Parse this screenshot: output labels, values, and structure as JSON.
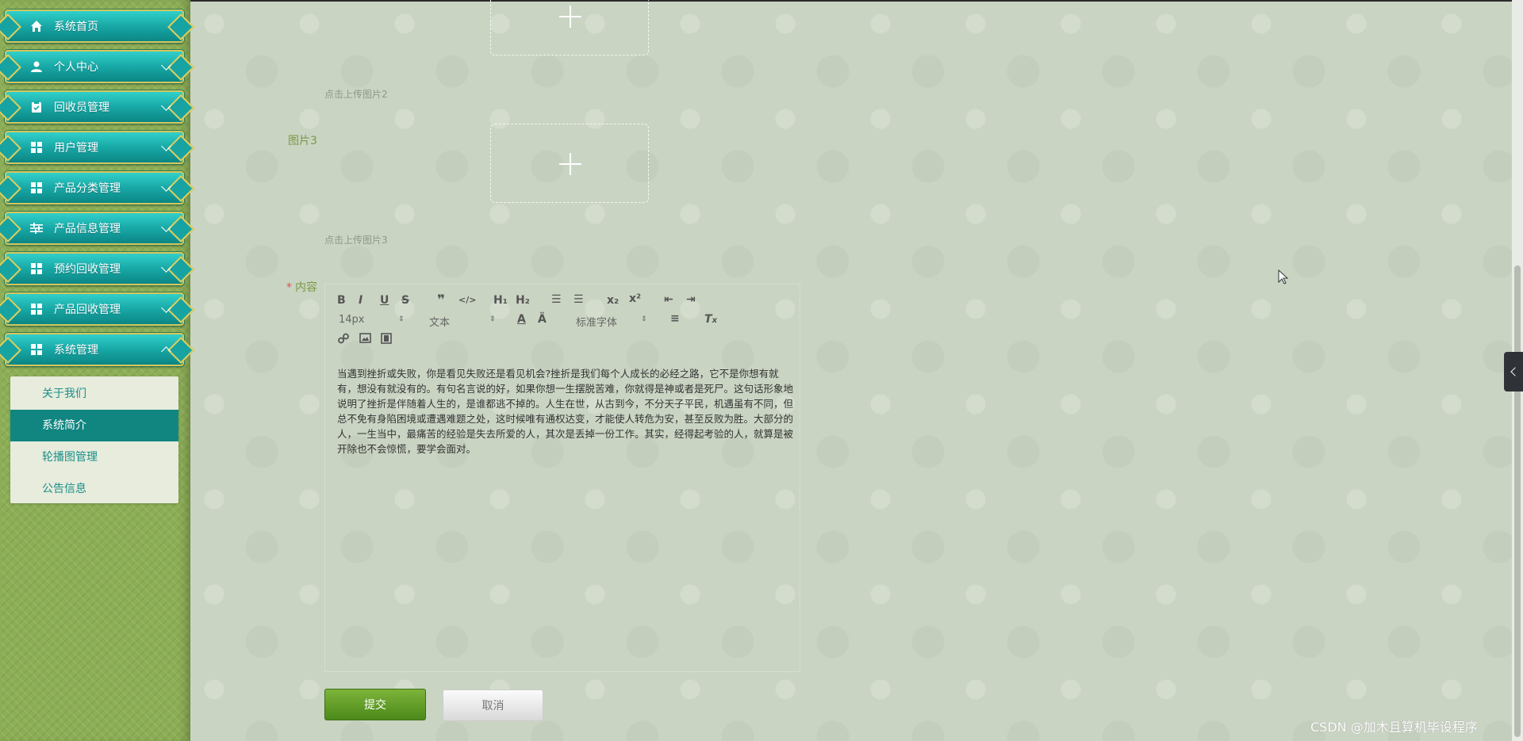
{
  "sidebar": {
    "menus": [
      {
        "label": "系统首页",
        "icon": "home-icon"
      },
      {
        "label": "个人中心",
        "icon": "user-icon"
      },
      {
        "label": "回收员管理",
        "icon": "clipboard-icon"
      },
      {
        "label": "用户管理",
        "icon": "grid-icon"
      },
      {
        "label": "产品分类管理",
        "icon": "grid-icon"
      },
      {
        "label": "产品信息管理",
        "icon": "sliders-icon"
      },
      {
        "label": "预约回收管理",
        "icon": "grid-icon"
      },
      {
        "label": "产品回收管理",
        "icon": "grid-icon"
      },
      {
        "label": "系统管理",
        "icon": "grid-icon"
      }
    ],
    "submenu": [
      {
        "label": "关于我们"
      },
      {
        "label": "系统简介",
        "active": true
      },
      {
        "label": "轮播图管理"
      },
      {
        "label": "公告信息"
      }
    ]
  },
  "form": {
    "upload2_tip": "点击上传图片2",
    "image3_label": "图片3",
    "upload3_tip": "点击上传图片3",
    "content_label": "内容",
    "required_mark": "*"
  },
  "editor": {
    "font_size": "14px",
    "paragraph": "文本",
    "font_family": "标准字体",
    "content": "当遇到挫折或失败，你是看见失败还是看见机会?挫折是我们每个人成长的必经之路，它不是你想有就有，想没有就没有的。有句名言说的好，如果你想一生摆脱苦难，你就得是神或者是死尸。这句话形象地说明了挫折是伴随着人生的，是谁都逃不掉的。人生在世，从古到今，不分天子平民，机遇虽有不同，但总不免有身陷困境或遭遇难题之处，这时候唯有通权达变，才能使人转危为安，甚至反败为胜。大部分的人，一生当中，最痛苦的经验是失去所爱的人，其次是丢掉一份工作。其实，经得起考验的人，就算是被开除也不会惊慌，要学会面对。"
  },
  "buttons": {
    "submit": "提交",
    "cancel": "取消"
  },
  "watermark": "CSDN @加木且算机毕设程序",
  "colors": {
    "menu_teal": "#18a8a6",
    "menu_border": "#d7c65b",
    "sidebar_green": "#8cae55",
    "active_sub": "#118580",
    "submit_green": "#5e9c22"
  }
}
